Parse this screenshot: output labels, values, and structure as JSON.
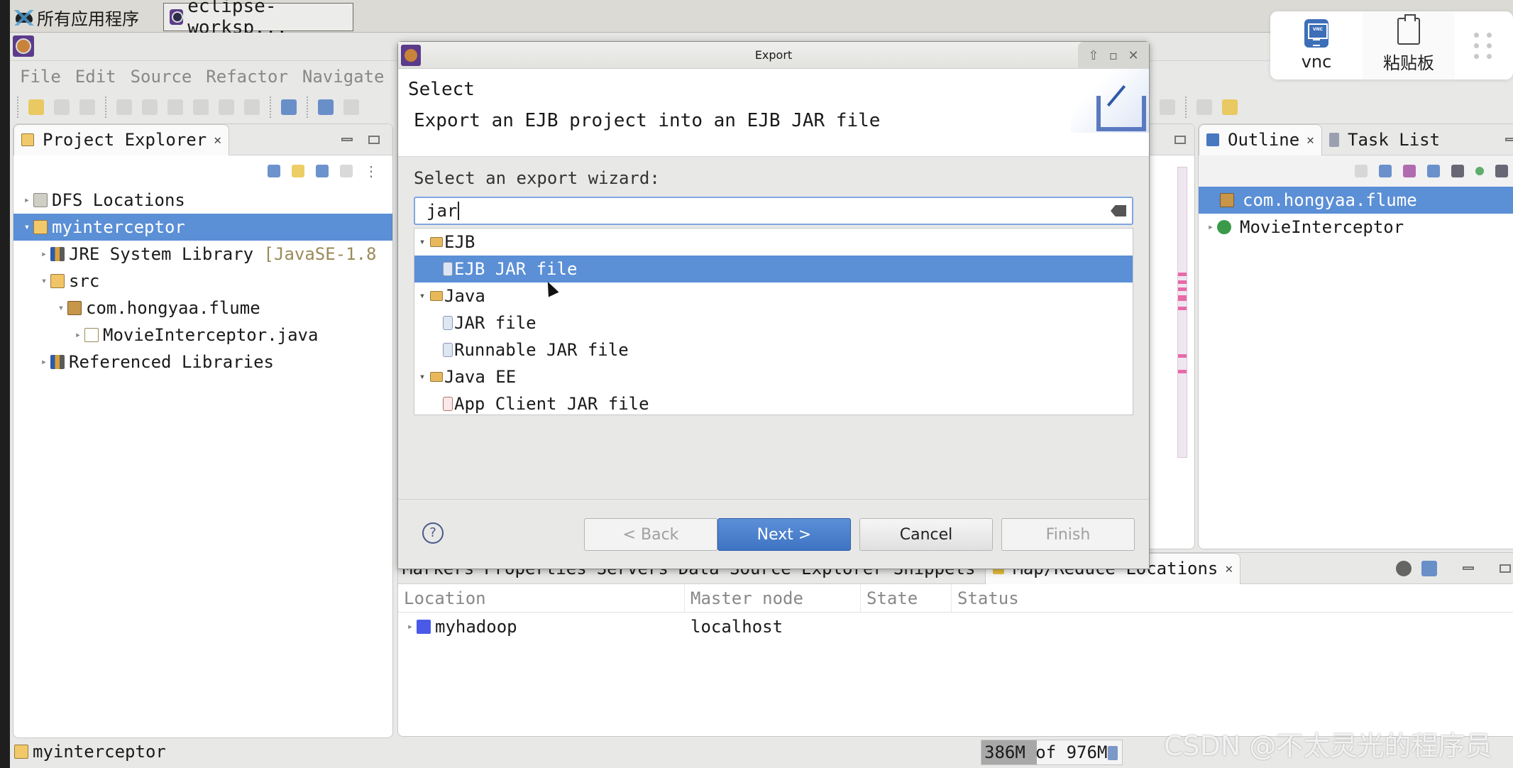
{
  "taskbar": {
    "apps_menu_label": "所有应用程序",
    "window_task_label": "eclipse-worksp..."
  },
  "vnc_panel": {
    "vnc_label": "vnc",
    "clipboard_label": "粘贴板"
  },
  "eclipse": {
    "menu": [
      "File",
      "Edit",
      "Source",
      "Refactor",
      "Navigate"
    ],
    "project_explorer": {
      "tab_label": "Project Explorer",
      "tree": [
        {
          "label": "DFS Locations",
          "depth": 0,
          "expanded": false,
          "icon": "dfs-icon"
        },
        {
          "label": "myinterceptor",
          "depth": 0,
          "expanded": true,
          "icon": "project-icon",
          "selected": true
        },
        {
          "label": "JRE System Library",
          "decoration": "[JavaSE-1.8",
          "depth": 1,
          "expanded": false,
          "icon": "library-icon"
        },
        {
          "label": "src",
          "depth": 1,
          "expanded": true,
          "icon": "source-folder-icon"
        },
        {
          "label": "com.hongyaa.flume",
          "depth": 2,
          "expanded": true,
          "icon": "package-icon"
        },
        {
          "label": "MovieInterceptor.java",
          "depth": 3,
          "expanded": false,
          "icon": "java-file-icon"
        },
        {
          "label": "Referenced Libraries",
          "depth": 1,
          "expanded": false,
          "icon": "library-icon"
        }
      ]
    },
    "outline": {
      "tab_label": "Outline",
      "task_list_label": "Task List",
      "tree": [
        {
          "label": "com.hongyaa.flume",
          "icon": "package-icon",
          "selected": true
        },
        {
          "label": "MovieInterceptor",
          "icon": "class-icon",
          "expanded": false
        }
      ]
    },
    "bottom_panel": {
      "tabs": [
        "Markers",
        "Properties",
        "Servers",
        "Data Source Explorer",
        "Snippets",
        "Map/Reduce Locations"
      ],
      "active_tab": "Map/Reduce Locations",
      "columns": [
        "Location",
        "Master node",
        "State",
        "Status"
      ],
      "rows": [
        {
          "location": "myhadoop",
          "master_node": "localhost",
          "state": "",
          "status": ""
        }
      ]
    },
    "status": {
      "selected_item": "myinterceptor",
      "heap_used": "386M",
      "heap_total": "976M",
      "heap_text": "386M of 976M",
      "heap_fraction": 0.395
    }
  },
  "dialog": {
    "title": "Export",
    "heading": "Select",
    "description": "Export an EJB project into an EJB JAR file",
    "wizard_label": "Select an export wizard:",
    "filter_value": "jar",
    "tree": [
      {
        "label": "EJB",
        "type": "category",
        "expanded": true
      },
      {
        "label": "EJB JAR file",
        "type": "wizard",
        "selected": true
      },
      {
        "label": "Java",
        "type": "category",
        "expanded": true
      },
      {
        "label": "JAR file",
        "type": "wizard"
      },
      {
        "label": "Runnable JAR file",
        "type": "wizard"
      },
      {
        "label": "Java EE",
        "type": "category",
        "expanded": true
      },
      {
        "label": "App Client JAR file",
        "type": "wizard"
      }
    ],
    "buttons": {
      "back": "< Back",
      "next": "Next >",
      "cancel": "Cancel",
      "finish": "Finish"
    },
    "help_glyph": "?"
  },
  "watermark": "CSDN @不太灵光的程序员"
}
